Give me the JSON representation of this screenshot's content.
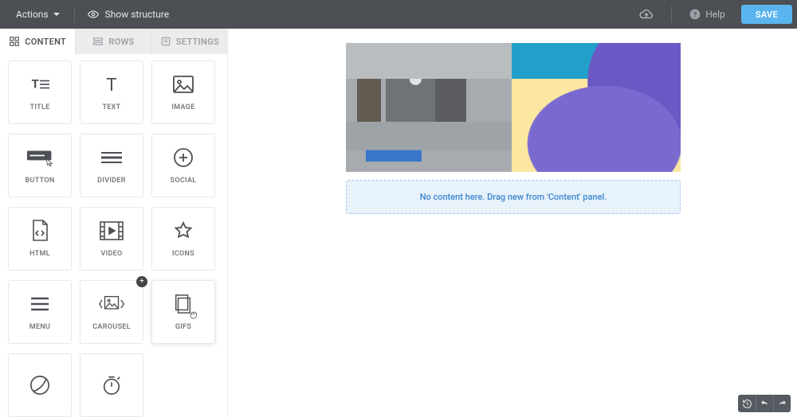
{
  "topbar": {
    "actions_label": "Actions",
    "show_structure_label": "Show structure",
    "help_label": "Help",
    "save_label": "SAVE"
  },
  "tabs": {
    "content": "CONTENT",
    "rows": "ROWS",
    "settings": "SETTINGS",
    "active": "content"
  },
  "blocks": [
    {
      "id": "title",
      "label": "TITLE",
      "icon": "title-icon"
    },
    {
      "id": "text",
      "label": "TEXT",
      "icon": "text-icon"
    },
    {
      "id": "image",
      "label": "IMAGE",
      "icon": "image-icon"
    },
    {
      "id": "button",
      "label": "BUTTON",
      "icon": "button-icon"
    },
    {
      "id": "divider",
      "label": "DIVIDER",
      "icon": "divider-icon"
    },
    {
      "id": "social",
      "label": "SOCIAL",
      "icon": "social-icon"
    },
    {
      "id": "html",
      "label": "HTML",
      "icon": "html-icon"
    },
    {
      "id": "video",
      "label": "VIDEO",
      "icon": "video-icon"
    },
    {
      "id": "icons",
      "label": "ICONS",
      "icon": "icons-icon"
    },
    {
      "id": "menu",
      "label": "MENU",
      "icon": "menu-icon"
    },
    {
      "id": "carousel",
      "label": "CAROUSEL",
      "icon": "carousel-icon",
      "badge": "+"
    },
    {
      "id": "gifs",
      "label": "GIFS",
      "icon": "gifs-icon",
      "selected": true
    },
    {
      "id": "sticker",
      "label": "",
      "icon": "sticker-icon"
    },
    {
      "id": "timer",
      "label": "",
      "icon": "timer-icon"
    }
  ],
  "canvas": {
    "dropzone_text": "No content here. Drag new from 'Content' panel."
  }
}
